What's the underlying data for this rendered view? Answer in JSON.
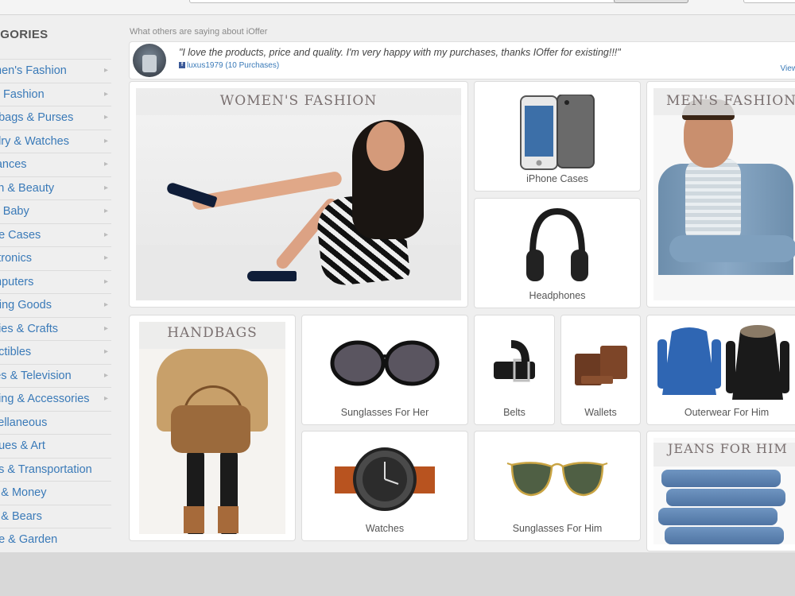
{
  "sidebar": {
    "title": "EGORIES",
    "items": [
      "men's Fashion",
      "'s Fashion",
      "dbags & Purses",
      "elry & Watches",
      "rances",
      "lth & Beauty",
      "& Baby",
      "ne Cases",
      "ctronics",
      "mputers",
      "rting Goods",
      "bies & Crafts",
      "ectibles",
      "ies & Television",
      "hing & Accessories",
      "cellaneous",
      "ques & Art",
      "os & Transportation",
      "s & Money",
      "s & Bears",
      "ne & Garden"
    ]
  },
  "testimonial": {
    "label": "What others are saying about iOffer",
    "quote": "\"I love the products, price and quality. I'm very happy with my purchases, thanks IOffer for existing!!!\"",
    "user": "luxus1979 (10 Purchases)",
    "view": "View"
  },
  "tiles": {
    "womens": "WOMEN'S FASHION",
    "iphone": "iPhone Cases",
    "headphones": "Headphones",
    "mens": "MEN'S FASHION",
    "handbags": "HANDBAGS",
    "sunglasses_her": "Sunglasses For Her",
    "belts": "Belts",
    "wallets": "Wallets",
    "outerwear": "Outerwear For Him",
    "watches": "Watches",
    "sunglasses_him": "Sunglasses For Him",
    "jeans": "JEANS FOR HIM"
  },
  "colors": {
    "link": "#3a7ab8",
    "facebook": "#3b5998"
  }
}
